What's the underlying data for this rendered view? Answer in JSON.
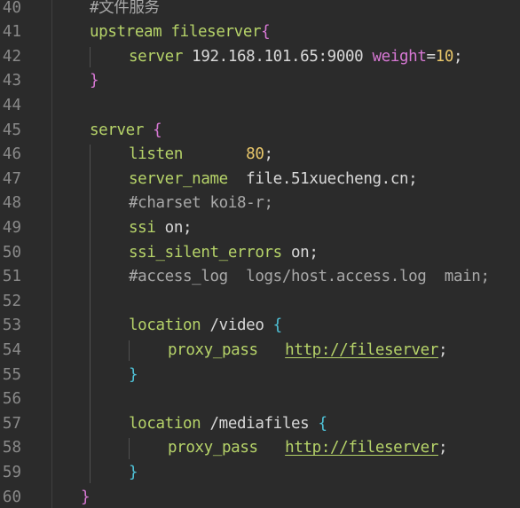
{
  "theme": {
    "background": "#2b2b2b",
    "line_number": "#8a8a8a",
    "keyword": "#b6d369",
    "number": "#e8c66a",
    "attribute": "#d778d4",
    "brace_outer": "#d778d4",
    "brace_inner": "#4fc3d9",
    "comment": "#a8a8a8"
  },
  "lines": [
    {
      "n": "40",
      "indent": 1,
      "tokens": [
        {
          "t": "#文件服务",
          "c": "cmt"
        }
      ]
    },
    {
      "n": "41",
      "indent": 1,
      "tokens": [
        {
          "t": "upstream",
          "c": "kw"
        },
        {
          "t": " ",
          "c": "plain"
        },
        {
          "t": "fileserver",
          "c": "fn"
        },
        {
          "t": "{",
          "c": "brace1"
        }
      ]
    },
    {
      "n": "42",
      "indent": 2,
      "tokens": [
        {
          "t": "server",
          "c": "kw"
        },
        {
          "t": " ",
          "c": "plain"
        },
        {
          "t": "192.168.101.65:9000",
          "c": "plain"
        },
        {
          "t": " ",
          "c": "plain"
        },
        {
          "t": "weight",
          "c": "attr"
        },
        {
          "t": "=",
          "c": "plain"
        },
        {
          "t": "10",
          "c": "num"
        },
        {
          "t": ";",
          "c": "plain"
        }
      ]
    },
    {
      "n": "43",
      "indent": 1,
      "tokens": [
        {
          "t": "}",
          "c": "brace1"
        }
      ]
    },
    {
      "n": "44",
      "indent": 0,
      "tokens": []
    },
    {
      "n": "45",
      "indent": 1,
      "tokens": [
        {
          "t": "server",
          "c": "kw"
        },
        {
          "t": " ",
          "c": "plain"
        },
        {
          "t": "{",
          "c": "brace1"
        }
      ]
    },
    {
      "n": "46",
      "indent": 2,
      "tokens": [
        {
          "t": "listen",
          "c": "kw"
        },
        {
          "t": "       ",
          "c": "plain"
        },
        {
          "t": "80",
          "c": "num"
        },
        {
          "t": ";",
          "c": "plain"
        }
      ]
    },
    {
      "n": "47",
      "indent": 2,
      "tokens": [
        {
          "t": "server_name",
          "c": "kw"
        },
        {
          "t": "  ",
          "c": "plain"
        },
        {
          "t": "file.51xuecheng.cn",
          "c": "plain"
        },
        {
          "t": ";",
          "c": "plain"
        }
      ]
    },
    {
      "n": "48",
      "indent": 2,
      "tokens": [
        {
          "t": "#charset koi8-r;",
          "c": "cmt"
        }
      ]
    },
    {
      "n": "49",
      "indent": 2,
      "tokens": [
        {
          "t": "ssi",
          "c": "kw"
        },
        {
          "t": " ",
          "c": "plain"
        },
        {
          "t": "on",
          "c": "plain"
        },
        {
          "t": ";",
          "c": "plain"
        }
      ]
    },
    {
      "n": "50",
      "indent": 2,
      "tokens": [
        {
          "t": "ssi_silent_errors",
          "c": "kw"
        },
        {
          "t": " ",
          "c": "plain"
        },
        {
          "t": "on",
          "c": "plain"
        },
        {
          "t": ";",
          "c": "plain"
        }
      ]
    },
    {
      "n": "51",
      "indent": 2,
      "tokens": [
        {
          "t": "#access_log  logs/host.access.log  main;",
          "c": "cmt"
        }
      ]
    },
    {
      "n": "52",
      "indent": 0,
      "tokens": []
    },
    {
      "n": "53",
      "indent": 2,
      "tokens": [
        {
          "t": "location",
          "c": "kw"
        },
        {
          "t": " ",
          "c": "plain"
        },
        {
          "t": "/video",
          "c": "plain"
        },
        {
          "t": " ",
          "c": "plain"
        },
        {
          "t": "{",
          "c": "brace2"
        }
      ]
    },
    {
      "n": "54",
      "indent": 3,
      "tokens": [
        {
          "t": "proxy_pass",
          "c": "kw"
        },
        {
          "t": "   ",
          "c": "plain"
        },
        {
          "t": "http://fileserver",
          "c": "url"
        },
        {
          "t": ";",
          "c": "plain"
        }
      ]
    },
    {
      "n": "55",
      "indent": 2,
      "tokens": [
        {
          "t": "}",
          "c": "brace2"
        }
      ]
    },
    {
      "n": "56",
      "indent": 0,
      "tokens": []
    },
    {
      "n": "57",
      "indent": 2,
      "tokens": [
        {
          "t": "location",
          "c": "kw"
        },
        {
          "t": " ",
          "c": "plain"
        },
        {
          "t": "/mediafiles",
          "c": "plain"
        },
        {
          "t": " ",
          "c": "plain"
        },
        {
          "t": "{",
          "c": "brace2"
        }
      ]
    },
    {
      "n": "58",
      "indent": 3,
      "tokens": [
        {
          "t": "proxy_pass",
          "c": "kw"
        },
        {
          "t": "   ",
          "c": "plain"
        },
        {
          "t": "http://fileserver",
          "c": "url"
        },
        {
          "t": ";",
          "c": "plain"
        }
      ]
    },
    {
      "n": "59",
      "indent": 2,
      "tokens": [
        {
          "t": "}",
          "c": "brace2"
        }
      ]
    },
    {
      "n": "60",
      "indent": 0.75,
      "tokens": [
        {
          "t": "}",
          "c": "brace1"
        }
      ]
    }
  ]
}
